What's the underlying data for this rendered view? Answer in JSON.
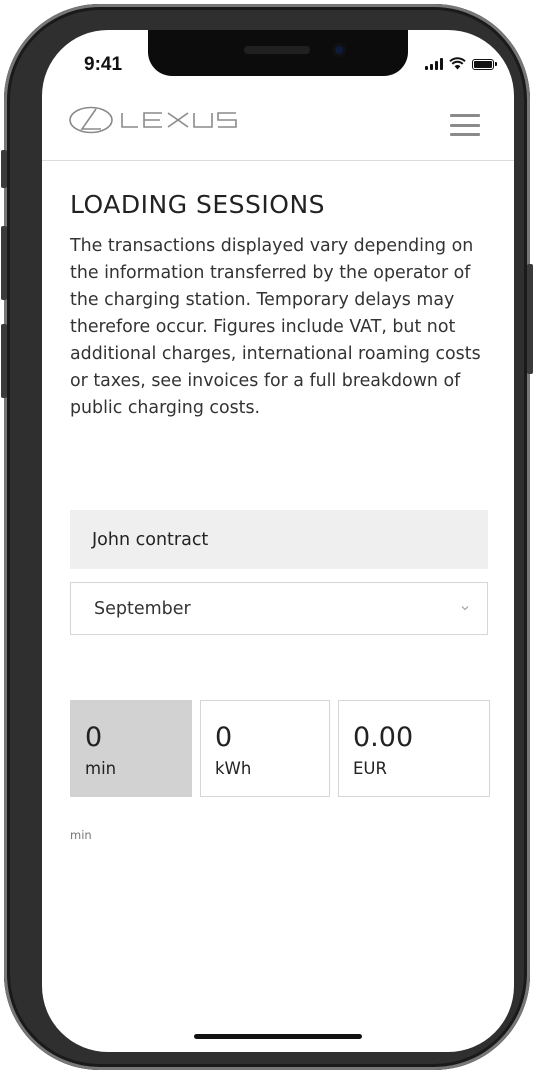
{
  "status_bar": {
    "time": "9:41"
  },
  "header": {
    "brand": "LEXUS",
    "menu_icon": "hamburger-menu-icon"
  },
  "page": {
    "title": "LOADING SESSIONS",
    "description": "The transactions displayed vary depending on the information transferred by the operator of the charging station. Temporary delays may therefore occur. Figures include VAT, but not additional charges, international roaming costs or taxes, see invoices for a full breakdown of public charging costs."
  },
  "contract": {
    "label": "John contract"
  },
  "month_select": {
    "value": "September",
    "icon": "chevron-down-icon"
  },
  "stats": [
    {
      "value": "0",
      "unit": "min",
      "selected": true
    },
    {
      "value": "0",
      "unit": "kWh",
      "selected": false
    },
    {
      "value": "0.00",
      "unit": "EUR",
      "selected": false
    }
  ],
  "footnote": "min",
  "colors": {
    "selected_stat_bg": "#d2d2d2",
    "contract_bg": "#efefef",
    "frame": "#2f2f2f"
  }
}
